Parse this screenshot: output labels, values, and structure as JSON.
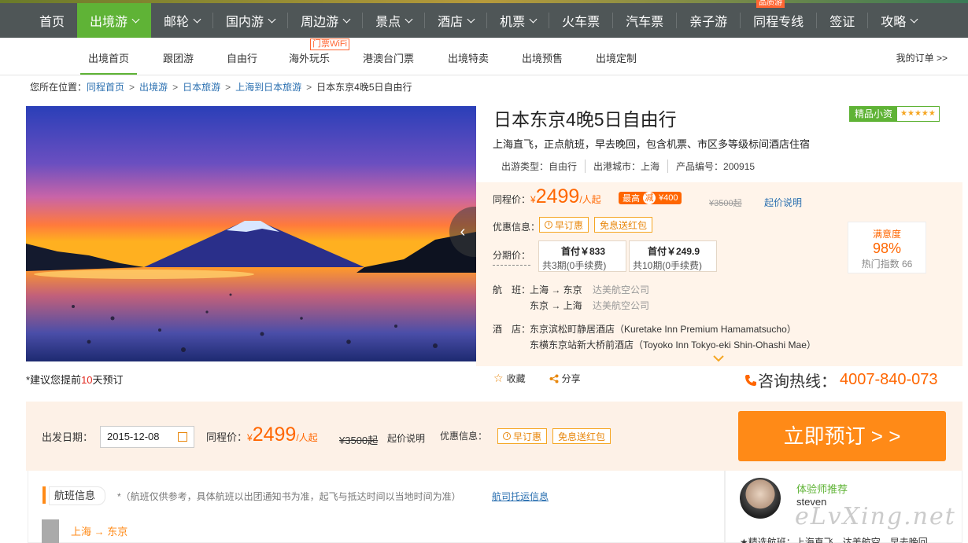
{
  "main_nav": {
    "items": [
      {
        "label": "首页",
        "active": false,
        "dropdown": false
      },
      {
        "label": "出境游",
        "active": true,
        "dropdown": true
      },
      {
        "label": "邮轮",
        "active": false,
        "dropdown": true
      },
      {
        "label": "国内游",
        "active": false,
        "dropdown": true
      },
      {
        "label": "周边游",
        "active": false,
        "dropdown": true
      },
      {
        "label": "景点",
        "active": false,
        "dropdown": true
      },
      {
        "label": "酒店",
        "active": false,
        "dropdown": true
      },
      {
        "label": "机票",
        "active": false,
        "dropdown": true
      },
      {
        "label": "火车票",
        "active": false,
        "dropdown": false
      },
      {
        "label": "汽车票",
        "active": false,
        "dropdown": false
      },
      {
        "label": "亲子游",
        "active": false,
        "dropdown": false
      },
      {
        "label": "同程专线",
        "active": false,
        "dropdown": false,
        "flag": "品质游"
      },
      {
        "label": "签证",
        "active": false,
        "dropdown": false
      },
      {
        "label": "攻略",
        "active": false,
        "dropdown": true
      }
    ]
  },
  "sub_nav": {
    "items": [
      "出境首页",
      "跟团游",
      "自由行",
      "海外玩乐",
      "港澳台门票",
      "出境特卖",
      "出境预售",
      "出境定制"
    ],
    "active_index": 0,
    "wifi_badge": "门票WiFi",
    "my_order": "我的订单 >>"
  },
  "breadcrumb": {
    "label": "您所在位置：",
    "links": [
      "同程首页",
      "出境游",
      "日本旅游",
      "上海到日本旅游"
    ],
    "current": "日本东京4晚5日自由行"
  },
  "product": {
    "title": "日本东京4晚5日自由行",
    "badge": "精品小资",
    "stars": "★★★★★",
    "subtitle": "上海直飞，正点航班，早去晚回，包含机票、市区多等级标间酒店住宿",
    "meta": [
      "出游类型：自由行",
      "出港城市：上海",
      "产品编号：200915"
    ],
    "advance_prefix": "*建议您提前",
    "advance_days": "10",
    "advance_suffix": "天预订"
  },
  "price_panel": {
    "price_label": "同程价：",
    "currency": "¥",
    "price": "2499",
    "unit": "/人起",
    "max_label": "最高",
    "cut_label": "减",
    "cut_amount": "¥400",
    "original": "¥3500起",
    "explain": "起价说明",
    "promo_label": "优惠信息：",
    "promos": [
      "早订惠",
      "免息送红包"
    ],
    "install_label": "分期价：",
    "installments": [
      {
        "title": "首付￥833",
        "sub": "共3期(0手续费)"
      },
      {
        "title": "首付￥249.9",
        "sub": "共10期(0手续费)"
      }
    ],
    "satisfaction_label": "满意度",
    "satisfaction": "98%",
    "hot_index": "热门指数 66",
    "flight_label": "航　班：",
    "flights": [
      {
        "route": "上海 → 东京",
        "airline": "达美航空公司"
      },
      {
        "route": "东京 → 上海",
        "airline": "达美航空公司"
      }
    ],
    "hotel_label": "酒　店：",
    "hotels": [
      "东京滨松町静居酒店（Kuretake Inn Premium Hamamatsucho）",
      "东横东京站新大桥前酒店（Toyoko Inn Tokyo-eki Shin-Ohashi Mae）"
    ]
  },
  "actions": {
    "favorite": "收藏",
    "share": "分享",
    "hotline_label": "咨询热线：",
    "hotline": "4007-840-073"
  },
  "booking": {
    "date_label": "出发日期：",
    "date": "2015-12-08",
    "price_label": "同程价：",
    "currency": "¥",
    "price": "2499",
    "unit": "/人起",
    "original": "¥3500起",
    "explain": "起价说明",
    "promo_label": "优惠信息：",
    "promos": [
      "早订惠",
      "免息送红包"
    ],
    "button": "立即预订 > >"
  },
  "flight_section": {
    "tab": "航班信息",
    "note": "*（航班仅供参考，具体航班以出团通知书为准，起飞与抵达时间以当地时间为准）",
    "link": "航司托运信息",
    "route": "上海 → 东京"
  },
  "expert": {
    "title": "体验师推荐",
    "name": "steven",
    "line": "★精选航班：上海直飞，达美航空，早去晚回"
  },
  "watermark": "eLvXing.net",
  "colors": {
    "nav_bg": "#4f5657",
    "nav_active": "#5fb336",
    "accent_orange": "#ff6600",
    "book_button": "#ff8a17",
    "link_blue": "#2a6fb0"
  }
}
